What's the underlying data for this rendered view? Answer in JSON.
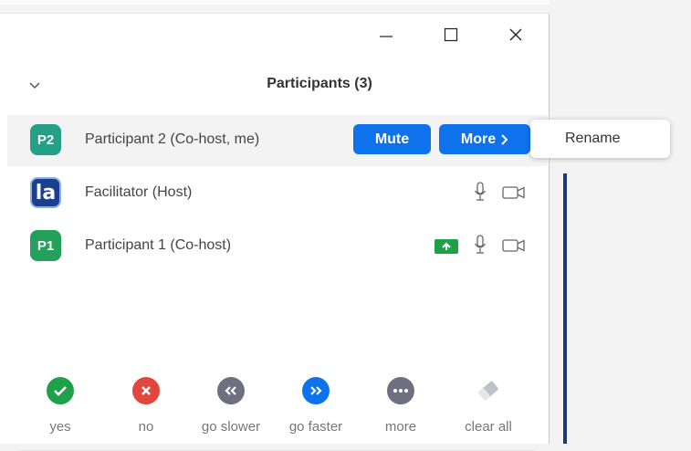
{
  "window": {
    "controls": [
      "minimize-icon",
      "maximize-icon",
      "close-icon"
    ]
  },
  "panel": {
    "title": "Participants (3)"
  },
  "participants": [
    {
      "initials": "P2",
      "name": "Participant 2 (Co-host, me)",
      "avatar_color": "#23a085"
    },
    {
      "initials": "la",
      "name": "Facilitator (Host)",
      "avatar_color": "#1a3f8f"
    },
    {
      "initials": "P1",
      "name": "Participant 1 (Co-host)",
      "avatar_color": "#23a05a"
    }
  ],
  "actions": {
    "mute": "Mute",
    "more": "More",
    "more_icon": "chevron-right-icon"
  },
  "popup_menu": {
    "items": [
      "Rename"
    ]
  },
  "reactions": [
    {
      "label": "yes",
      "icon": "check-icon",
      "color": "#1fa14a"
    },
    {
      "label": "no",
      "icon": "x-icon",
      "color": "#e2463f"
    },
    {
      "label": "go slower",
      "icon": "double-chevron-left-icon",
      "color": "#6f6f80"
    },
    {
      "label": "go faster",
      "icon": "double-chevron-right-icon",
      "color": "#0e72ed"
    },
    {
      "label": "more",
      "icon": "ellipsis-icon",
      "color": "#6f6f80"
    },
    {
      "label": "clear all",
      "icon": "eraser-icon",
      "color": "#c0c0c8"
    }
  ],
  "colors": {
    "accent": "#0e72ed",
    "share_green": "#1fa14a",
    "row_highlight": "#f3f3f3"
  }
}
